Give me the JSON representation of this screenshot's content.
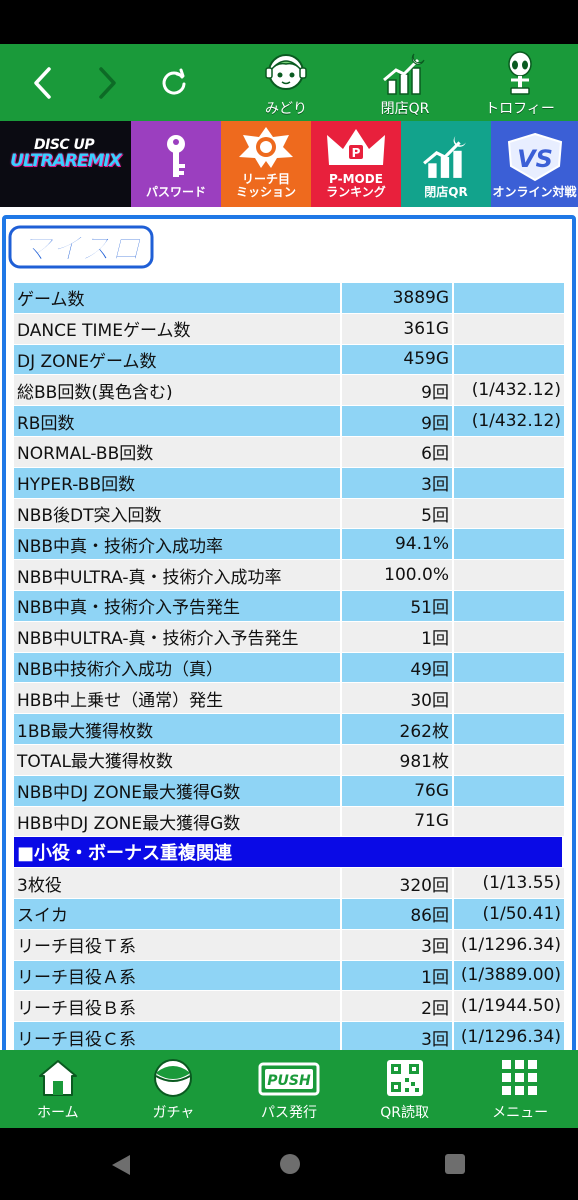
{
  "topbar": {
    "icons": [
      {
        "label": "みどり",
        "icon": "midori-character-icon"
      },
      {
        "label": "閉店QR",
        "icon": "closing-qr-icon"
      },
      {
        "label": "トロフィー",
        "icon": "trophy-alien-icon"
      }
    ]
  },
  "banner": {
    "logo_top": "DISC UP",
    "logo_bottom": "ULTRAREMIX",
    "tiles": [
      {
        "label": "パスワード",
        "color": "#9b3fbf",
        "icon": "key-icon"
      },
      {
        "label": "リーチ目\nミッション",
        "color": "#ee6a1e",
        "icon": "mission-badge-icon"
      },
      {
        "label": "P-MODE\nランキング",
        "color": "#e8203c",
        "icon": "crown-icon"
      },
      {
        "label": "閉店QR",
        "color": "#12a38c",
        "icon": "closing-qr-icon"
      },
      {
        "label": "オンライン対戦",
        "color": "#3b5fd6",
        "icon": "vs-icon"
      }
    ]
  },
  "myslo_logo": "マイスロ",
  "stats": [
    {
      "label": "ゲーム数",
      "value": "3889G",
      "ratio": ""
    },
    {
      "label": "DANCE TIMEゲーム数",
      "value": "361G",
      "ratio": ""
    },
    {
      "label": "DJ ZONEゲーム数",
      "value": "459G",
      "ratio": ""
    },
    {
      "label": "総BB回数(異色含む)",
      "value": "9回",
      "ratio": "(1/432.12)"
    },
    {
      "label": "RB回数",
      "value": "9回",
      "ratio": "(1/432.12)"
    },
    {
      "label": "NORMAL-BB回数",
      "value": "6回",
      "ratio": ""
    },
    {
      "label": "HYPER-BB回数",
      "value": "3回",
      "ratio": ""
    },
    {
      "label": "NBB後DT突入回数",
      "value": "5回",
      "ratio": ""
    },
    {
      "label": "NBB中真・技術介入成功率",
      "value": "94.1%",
      "ratio": ""
    },
    {
      "label": "NBB中ULTRA-真・技術介入成功率",
      "value": "100.0%",
      "ratio": ""
    },
    {
      "label": "NBB中真・技術介入予告発生",
      "value": "51回",
      "ratio": ""
    },
    {
      "label": "NBB中ULTRA-真・技術介入予告発生",
      "value": "1回",
      "ratio": ""
    },
    {
      "label": "NBB中技術介入成功（真）",
      "value": "49回",
      "ratio": ""
    },
    {
      "label": "HBB中上乗せ（通常）発生",
      "value": "30回",
      "ratio": ""
    },
    {
      "label": "1BB最大獲得枚数",
      "value": "262枚",
      "ratio": ""
    },
    {
      "label": "TOTAL最大獲得枚数",
      "value": "981枚",
      "ratio": ""
    },
    {
      "label": "NBB中DJ ZONE最大獲得G数",
      "value": "76G",
      "ratio": ""
    },
    {
      "label": "HBB中DJ ZONE最大獲得G数",
      "value": "71G",
      "ratio": ""
    }
  ],
  "section_title": "■小役・ボーナス重複関連",
  "small_roles": [
    {
      "label": "3枚役",
      "value": "320回",
      "ratio": "(1/13.55)"
    },
    {
      "label": "スイカ",
      "value": "86回",
      "ratio": "(1/50.41)"
    },
    {
      "label": "リーチ目役Ｔ系",
      "value": "3回",
      "ratio": "(1/1296.34)"
    },
    {
      "label": "リーチ目役Ａ系",
      "value": "1回",
      "ratio": "(1/3889.00)"
    },
    {
      "label": "リーチ目役Ｂ系",
      "value": "2回",
      "ratio": "(1/1944.50)"
    },
    {
      "label": "リーチ目役Ｃ系",
      "value": "3回",
      "ratio": "(1/1296.34)"
    }
  ],
  "bottom_nav": [
    {
      "label": "ホーム",
      "icon": "home-icon"
    },
    {
      "label": "ガチャ",
      "icon": "gacha-icon"
    },
    {
      "label": "パス発行",
      "icon": "push-pass-icon"
    },
    {
      "label": "QR読取",
      "icon": "qr-code-icon"
    },
    {
      "label": "メニュー",
      "icon": "menu-grid-icon"
    }
  ],
  "colors": {
    "green": "#1a9a3a",
    "frame_blue": "#1f78e6",
    "row_blue": "#8fd4f5",
    "row_gray": "#efefef",
    "section_blue": "#0a0ae6"
  }
}
